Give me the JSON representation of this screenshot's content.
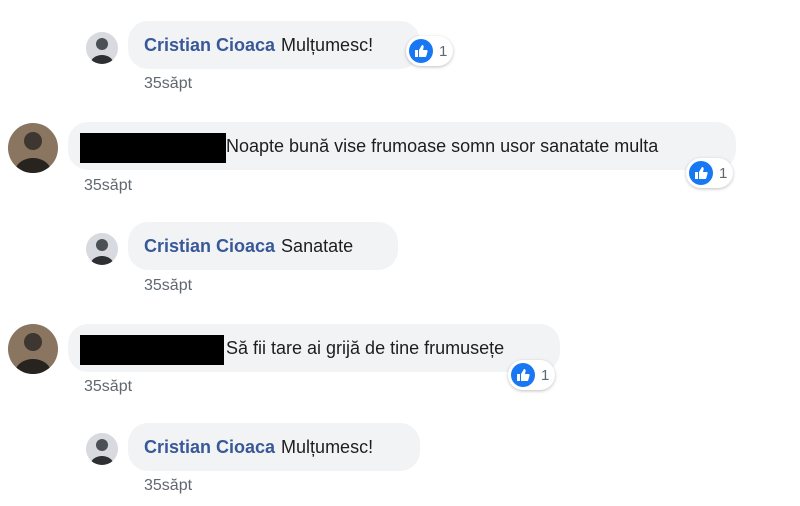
{
  "comments": [
    {
      "author": "Cristian Cioaca",
      "text": "Mulțumesc!",
      "time": "35săpt",
      "reaction_count": "1"
    },
    {
      "author": "",
      "text": "Noapte bună vise frumoase somn usor sanatate multa",
      "time": "35săpt",
      "reaction_count": "1"
    },
    {
      "author": "Cristian Cioaca",
      "text": "Sanatate",
      "time": "35săpt"
    },
    {
      "author": "",
      "text": "Să fii tare ai grijă de tine frumusețe",
      "time": "35săpt",
      "reaction_count": "1"
    },
    {
      "author": "Cristian Cioaca",
      "text": "Mulțumesc!",
      "time": "35săpt"
    }
  ],
  "colors": {
    "author": "#385898",
    "bubble": "#f2f3f5",
    "like": "#1877f2"
  },
  "icons": {
    "reaction": "like-icon"
  }
}
